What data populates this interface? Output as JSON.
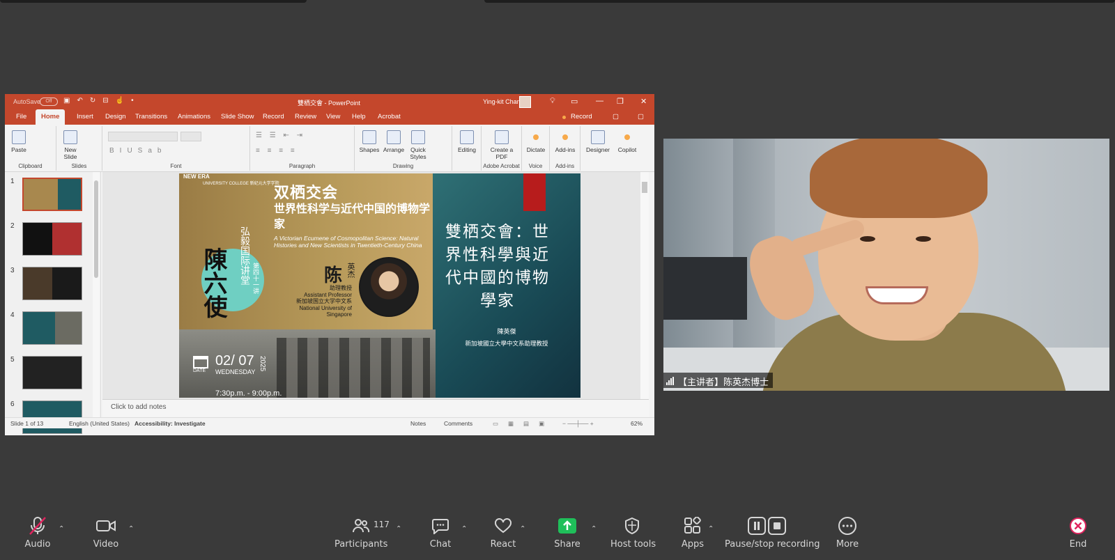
{
  "ppt": {
    "autosave": "AutoSave",
    "autosave_state": "Off",
    "doc_title": "雙栖交會 - PowerPoint",
    "user": "Ying-kit Chan",
    "tabs": [
      "File",
      "Home",
      "Insert",
      "Design",
      "Transitions",
      "Animations",
      "Slide Show",
      "Record",
      "Review",
      "View",
      "Help",
      "Acrobat"
    ],
    "record_button": "Record",
    "ribbon": {
      "paste": "Paste",
      "new_slide": "New Slide",
      "shapes": "Shapes",
      "arrange": "Arrange",
      "quick_styles": "Quick Styles",
      "editing": "Editing",
      "create_pdf": "Create a PDF",
      "dictate": "Dictate",
      "addins": "Add-ins",
      "designer": "Designer",
      "copilot": "Copilot",
      "groups": {
        "clipboard": "Clipboard",
        "slides": "Slides",
        "font": "Font",
        "paragraph": "Paragraph",
        "drawing": "Drawing",
        "adobe": "Adobe Acrobat",
        "voice": "Voice",
        "addins": "Add-ins"
      }
    },
    "thumbnails": [
      "1",
      "2",
      "3",
      "4",
      "5",
      "6"
    ],
    "slide": {
      "logo": "NEW ERA",
      "logo_sub": "UNIVERSITY COLLEGE 新纪元大学学院",
      "title_cn": "双栖交会",
      "subtitle_cn": "世界性科学与近代中国的博物学家",
      "title_en": "A Victorian Ecumene of Cosmopolitan Science: Natural Histories and New Scientists in Twentieth-Century China",
      "series_vertical": "弘毅国际讲堂",
      "series_sub": "第四十一讲",
      "calligraphy": "陳六使",
      "speaker_surname": "陈",
      "speaker_given": "英杰",
      "affiliation": "助理教授\nAssistant Professor\n新加坡国立大学中文系\nNational University of Singapore",
      "right_title": "雙栖交會：世界性科學與近代中國的博物學家",
      "right_name": "陳英傑",
      "right_position": "新加坡國立大學中文系助理教授",
      "date": "02/ 07",
      "date_label": "DATE",
      "weekday": "WEDNESDAY",
      "year": "2025",
      "time": "7:30p.m. - 9:00p.m."
    },
    "notes_placeholder": "Click to add notes",
    "status": {
      "slide_count": "Slide 1 of 13",
      "language": "English (United States)",
      "accessibility": "Accessibility: Investigate",
      "notes": "Notes",
      "comments": "Comments",
      "zoom": "62%"
    }
  },
  "video": {
    "name": "【主讲者】陈英杰博士"
  },
  "toolbar": {
    "audio": "Audio",
    "video": "Video",
    "participants": "Participants",
    "participants_count": "117",
    "chat": "Chat",
    "react": "React",
    "share": "Share",
    "host_tools": "Host tools",
    "apps": "Apps",
    "recording": "Pause/stop recording",
    "more": "More",
    "end": "End"
  },
  "colors": {
    "ppt_accent": "#c4472c",
    "share_green": "#1fbf5a",
    "end_red": "#e0245e",
    "background": "#3a3a3a"
  }
}
